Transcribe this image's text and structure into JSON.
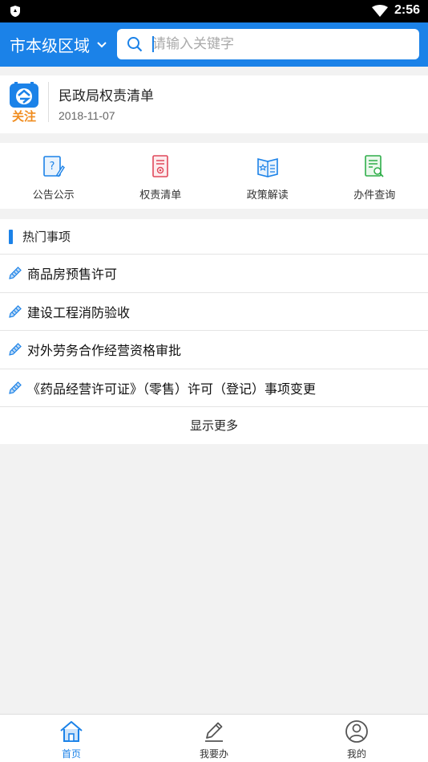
{
  "status_bar": {
    "time": "2:56"
  },
  "header": {
    "region_label": "市本级区域",
    "search_placeholder": "请输入关键字"
  },
  "notice": {
    "logo_text": "关注",
    "title": "民政局权责清单",
    "date": "2018-11-07"
  },
  "quick_links": [
    {
      "label": "公告公示",
      "icon": "question-doc-icon"
    },
    {
      "label": "权责清单",
      "icon": "list-doc-icon"
    },
    {
      "label": "政策解读",
      "icon": "open-book-icon"
    },
    {
      "label": "办件查询",
      "icon": "search-doc-icon"
    }
  ],
  "hot_items": {
    "title": "热门事项",
    "items": [
      "商品房预售许可",
      "建设工程消防验收",
      "对外劳务合作经营资格审批",
      "《药品经营许可证》（零售）许可（登记）事项变更"
    ],
    "more_label": "显示更多"
  },
  "tabs": [
    {
      "label": "首页",
      "icon": "home-icon",
      "active": true
    },
    {
      "label": "我要办",
      "icon": "pencil-icon",
      "active": false
    },
    {
      "label": "我的",
      "icon": "user-icon",
      "active": false
    }
  ],
  "colors": {
    "primary": "#1b82e8",
    "logo_orange": "#f08c1e"
  }
}
